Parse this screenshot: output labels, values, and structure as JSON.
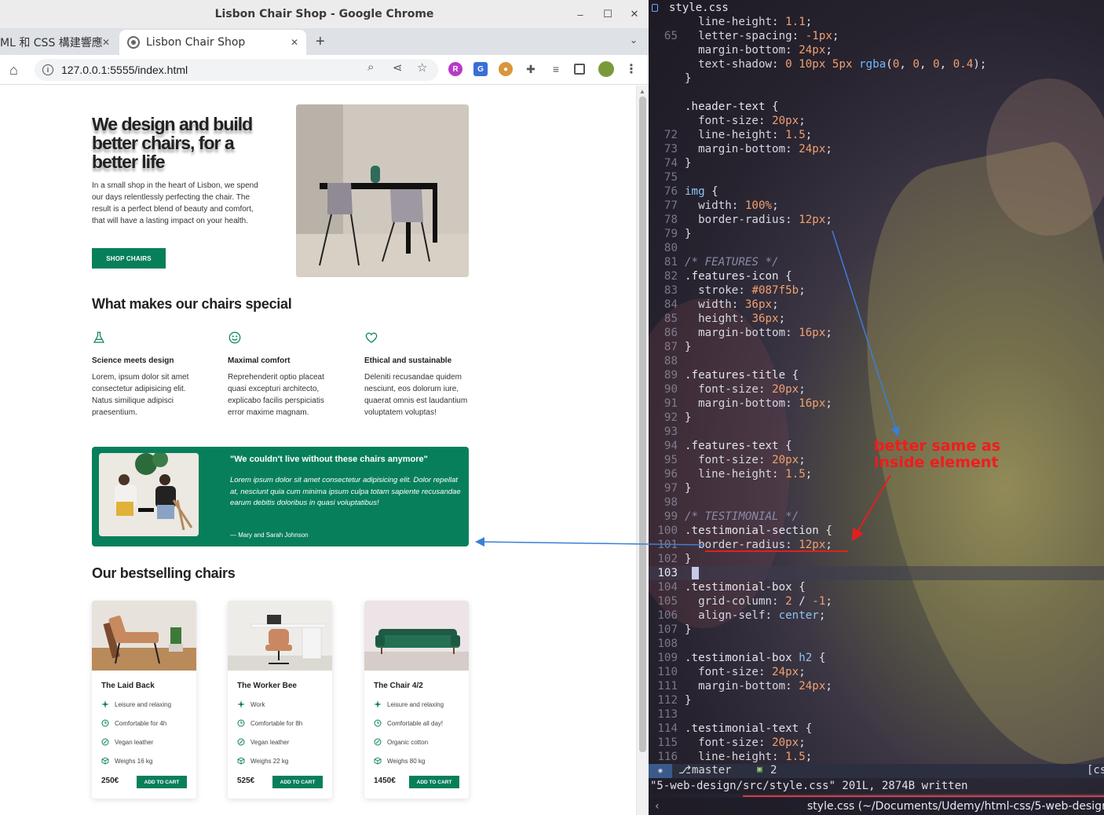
{
  "browser": {
    "window_title": "Lisbon Chair Shop - Google Chrome",
    "tabs": [
      {
        "label": "ML 和 CSS 構建響應"
      },
      {
        "label": "Lisbon Chair Shop"
      }
    ],
    "new_tab": "+",
    "url": "127.0.0.1:5555/index.html",
    "minimize": "–",
    "maximize": "☐",
    "close": "✕"
  },
  "page": {
    "hero": {
      "title": "We design and build better chairs, for a better life",
      "text": "In a small shop in the heart of Lisbon, we spend our days relentlessly perfecting the chair. The result is a perfect blend of beauty and comfort, that will have a lasting impact on your health.",
      "button": "SHOP CHAIRS"
    },
    "features": {
      "title": "What makes our chairs special",
      "items": [
        {
          "title": "Science meets design",
          "text": "Lorem, ipsum dolor sit amet consectetur adipisicing elit. Natus similique adipisci praesentium.",
          "icon": "flask-icon"
        },
        {
          "title": "Maximal comfort",
          "text": "Reprehenderit optio placeat quasi excepturi architecto, explicabo facilis perspiciatis error maxime magnam.",
          "icon": "smile-icon"
        },
        {
          "title": "Ethical and sustainable",
          "text": "Deleniti recusandae quidem nesciunt, eos dolorum iure, quaerat omnis est laudantium voluptatem voluptas!",
          "icon": "heart-icon"
        }
      ]
    },
    "testimonial": {
      "title": "\"We couldn't live without these chairs anymore\"",
      "text": "Lorem ipsum dolor sit amet consectetur adipisicing elit. Dolor repellat at, nesciunt quia cum minima ipsum culpa totam sapiente recusandae earum debitis doloribus in quasi voluptatibus!",
      "author": "— Mary and Sarah Johnson"
    },
    "bestsellers": {
      "title": "Our bestselling chairs",
      "cards": [
        {
          "name": "The Laid Back",
          "attrs": [
            "Leisure and relaxing",
            "Comfortable for 4h",
            "Vegan leather",
            "Weighs 16 kg"
          ],
          "price": "250€",
          "button": "ADD TO CART"
        },
        {
          "name": "The Worker Bee",
          "attrs": [
            "Work",
            "Comfortable for 8h",
            "Vegan leather",
            "Weighs 22 kg"
          ],
          "price": "525€",
          "button": "ADD TO CART"
        },
        {
          "name": "The Chair 4/2",
          "attrs": [
            "Leisure and relaxing",
            "Comfortable all day!",
            "Organic cotton",
            "Weighs 80 kg"
          ],
          "price": "1450€",
          "button": "ADD TO CART"
        }
      ]
    }
  },
  "editor": {
    "file_name": "style.css",
    "branch": "master",
    "count": "2",
    "right_marker": "[cs",
    "message": "\"5-web-design/src/style.css\" 201L, 2874B written",
    "bottom_path": "style.css (~/Documents/Udemy/html-css/5-web-design/s",
    "annotation": "better same as inside element",
    "accent_color": "#087f5b"
  },
  "colors": {
    "brand_green": "#087f5b",
    "annotation_red": "#f01c1c",
    "arrow_blue": "#3a7fd6"
  }
}
